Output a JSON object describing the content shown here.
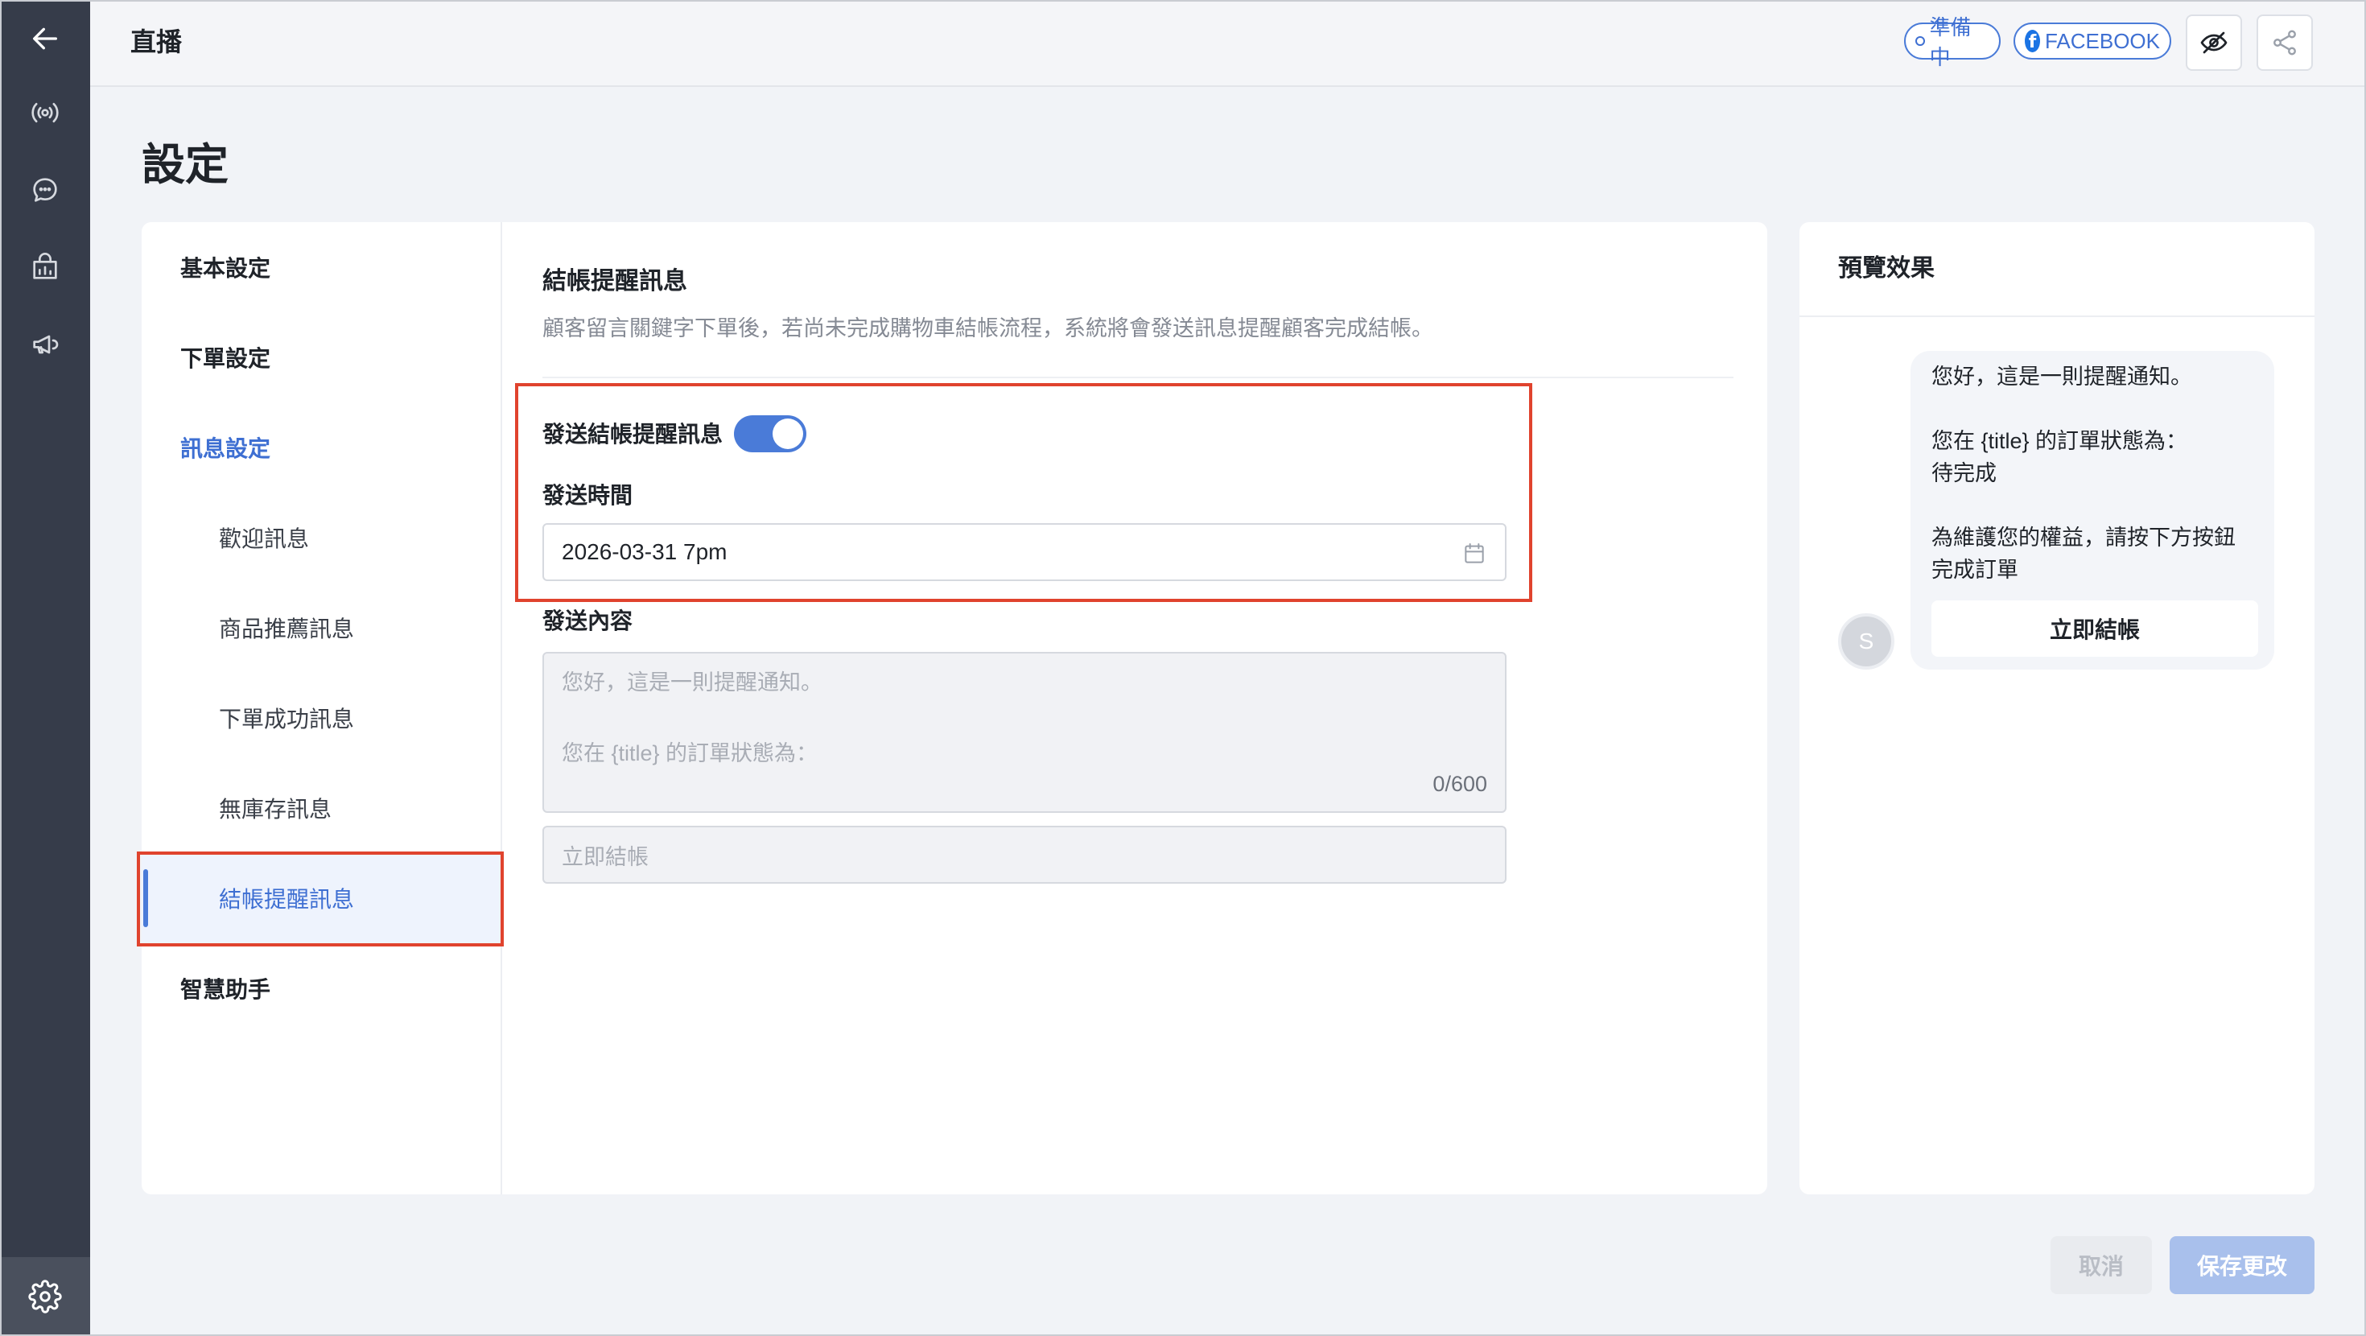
{
  "rail": {
    "items": [
      {
        "icon": "back-arrow-icon"
      },
      {
        "icon": "broadcast-icon"
      },
      {
        "icon": "chat-bubble-icon"
      },
      {
        "icon": "shop-bag-icon"
      },
      {
        "icon": "megaphone-icon"
      }
    ],
    "bottom_icon": "gear-icon"
  },
  "topbar": {
    "title": "直播",
    "status_label": "準備中",
    "platform_label": "FACEBOOK",
    "preview_icon": "eye-slash-icon",
    "share_icon": "share-icon"
  },
  "page": {
    "title": "設定"
  },
  "nav": {
    "items": [
      {
        "label": "基本設定"
      },
      {
        "label": "下單設定"
      },
      {
        "label": "訊息設定"
      },
      {
        "label": "歡迎訊息"
      },
      {
        "label": "商品推薦訊息"
      },
      {
        "label": "下單成功訊息"
      },
      {
        "label": "無庫存訊息"
      },
      {
        "label": "結帳提醒訊息"
      },
      {
        "label": "智慧助手"
      }
    ],
    "active_index": 7
  },
  "section": {
    "title": "結帳提醒訊息",
    "description": "顧客留言關鍵字下單後，若尚未完成購物車結帳流程，系統將會發送訊息提醒顧客完成結帳。"
  },
  "form": {
    "toggle_label": "發送結帳提醒訊息",
    "toggle_on": true,
    "time_label": "發送時間",
    "time_value": "2026-03-31 7pm",
    "content_label": "發送內容",
    "content_placeholder_line1": "您好，這是一則提醒通知。",
    "content_placeholder_line2": "您在 {title} 的訂單狀態為：",
    "char_count": "0/600",
    "button_placeholder": "立即結帳"
  },
  "preview": {
    "title": "預覽效果",
    "avatar_letter": "S",
    "message": "您好，這是一則提醒通知。\n\n您在 {title} 的訂單狀態為：\n待完成\n\n為維護您的權益，請按下方按鈕\n完成訂單",
    "button_label": "立即結帳"
  },
  "footer": {
    "cancel_label": "取消",
    "save_label": "保存更改"
  },
  "colors": {
    "accent": "#4a7bd8",
    "rail": "#363c4a",
    "highlight": "#e0432e"
  }
}
